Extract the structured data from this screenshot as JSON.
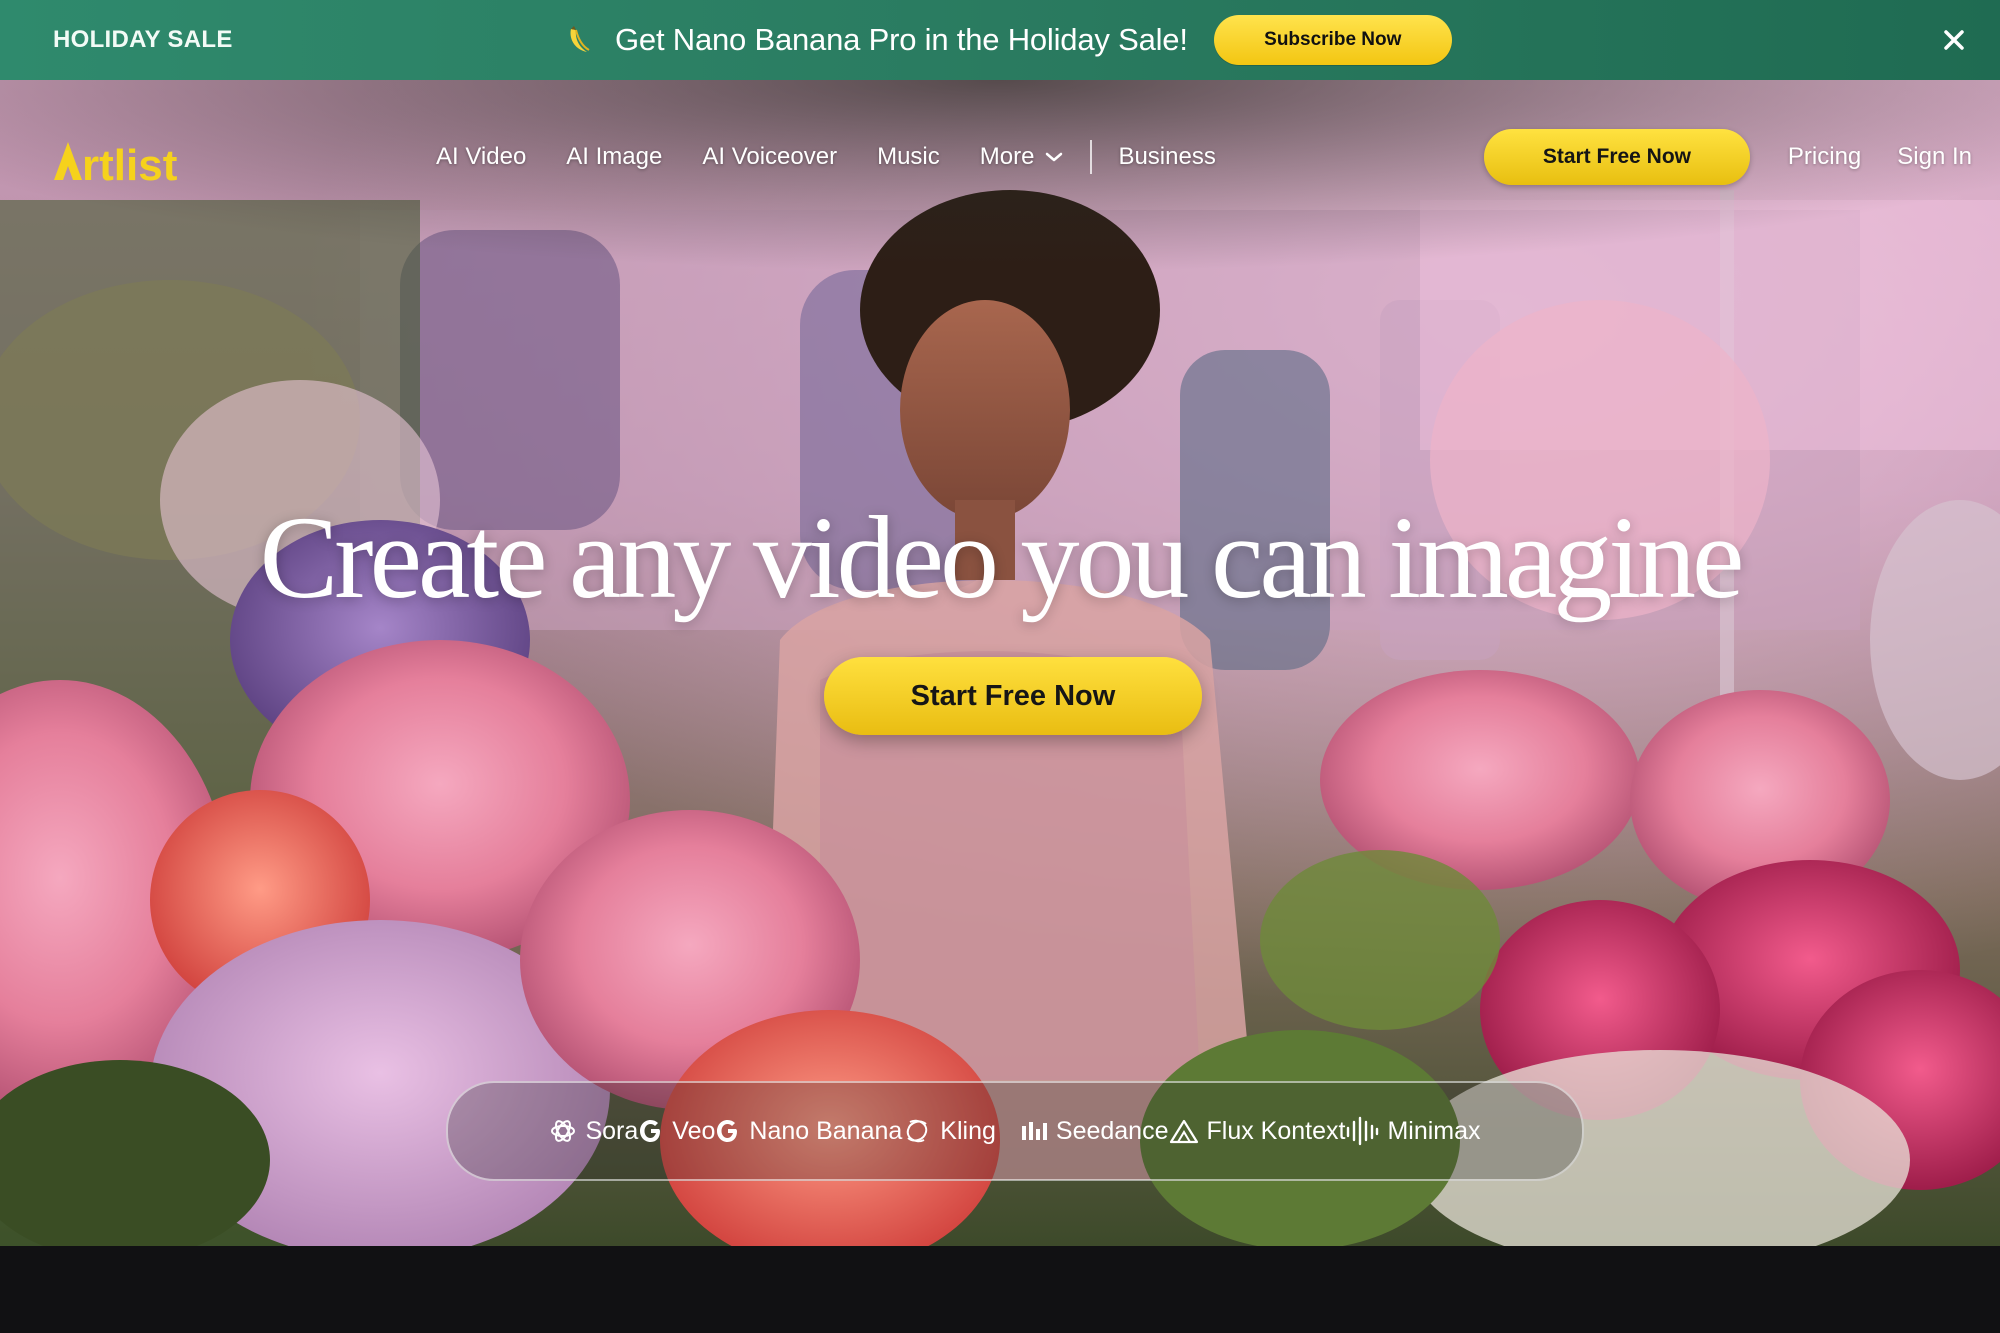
{
  "promo": {
    "tag": "HOLIDAY SALE",
    "headline": "Get Nano Banana Pro in the Holiday Sale!",
    "subscribe_label": "Subscribe Now",
    "icon": "banana-icon"
  },
  "nav": {
    "logo": "Artlist",
    "links": [
      "AI Video",
      "AI Image",
      "AI Voiceover",
      "Music"
    ],
    "more_label": "More",
    "business_label": "Business",
    "cta_label": "Start Free Now",
    "pricing_label": "Pricing",
    "signin_label": "Sign In"
  },
  "hero": {
    "title": "Create any video you can imagine",
    "cta_label": "Start Free Now"
  },
  "models": [
    {
      "name": "Sora",
      "icon": "openai-icon"
    },
    {
      "name": "Veo",
      "icon": "google-icon"
    },
    {
      "name": "Nano Banana",
      "icon": "google-icon"
    },
    {
      "name": "Kling",
      "icon": "kling-icon"
    },
    {
      "name": "Seedance",
      "icon": "bytedance-icon"
    },
    {
      "name": "Flux Kontext",
      "icon": "flux-icon"
    },
    {
      "name": "Minimax",
      "icon": "minimax-icon"
    }
  ],
  "colors": {
    "accent_yellow": "#f5cf1f",
    "promo_green": "#2a7b60",
    "logo_yellow": "#f6d21c"
  }
}
